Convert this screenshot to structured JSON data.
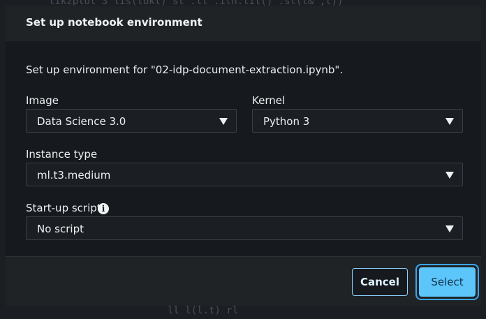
{
  "dialog": {
    "title": "Set up notebook environment",
    "description": "Set up environment for \"02-idp-document-extraction.ipynb\"."
  },
  "fields": {
    "image": {
      "label": "Image",
      "value": "Data Science 3.0"
    },
    "kernel": {
      "label": "Kernel",
      "value": "Python 3"
    },
    "instance_type": {
      "label": "Instance type",
      "value": "ml.t3.medium"
    },
    "startup_script": {
      "label": "Start-up script",
      "value": "No script",
      "info_icon": "info-icon"
    }
  },
  "footer": {
    "cancel_label": "Cancel",
    "select_label": "Select"
  },
  "colors": {
    "accent": "#5cc6fb",
    "focus_ring": "#3aa6f0",
    "background": "#16191d",
    "header": "#202326"
  }
}
